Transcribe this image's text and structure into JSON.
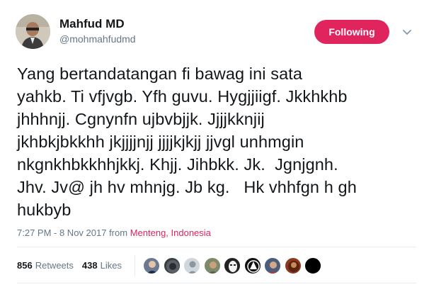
{
  "user": {
    "display_name": "Mahfud MD",
    "handle": "@mohmahfudmd"
  },
  "follow_button": {
    "label": "Following",
    "color": "#e0245e"
  },
  "tweet": {
    "lines": [
      "Yang bertandatangan fi bawag ini sata",
      "yahkb. Ti vfjvgb. Yfh guvu. Hygjjiigf. Jkkhkhb",
      "jhhhnjj. Cgnynfn ujbvbjjk. Jjjjkknjij",
      "jkhbkjbkkhh jkjjjjnjj jjjjkjkjj jjvgl unhmgin",
      "nkgnkhbkkhhjkkj. Khjj. Jihbkk. Jk.  Jgnjgnh.",
      "Jhv. Jv@ jh hv mhnjg. Jb kg.   Hk vhhfgn h gh",
      "hukbyb"
    ],
    "timestamp": "7:27 PM - 8 Nov 2017 from",
    "location": "Menteng, Indonesia"
  },
  "stats": {
    "retweets_count": "856",
    "retweets_label": "Retweets",
    "likes_count": "438",
    "likes_label": "Likes"
  },
  "likers": [
    {
      "bg": "#6b7a8f"
    },
    {
      "bg": "#3a3f44"
    },
    {
      "bg": "#cfd6dc"
    },
    {
      "bg": "#7d8a6a"
    },
    {
      "bg": "#222222"
    },
    {
      "bg": "#111111"
    },
    {
      "bg": "#4a5d7a"
    },
    {
      "bg": "#8b3a1e"
    },
    {
      "bg": "#000000"
    }
  ]
}
